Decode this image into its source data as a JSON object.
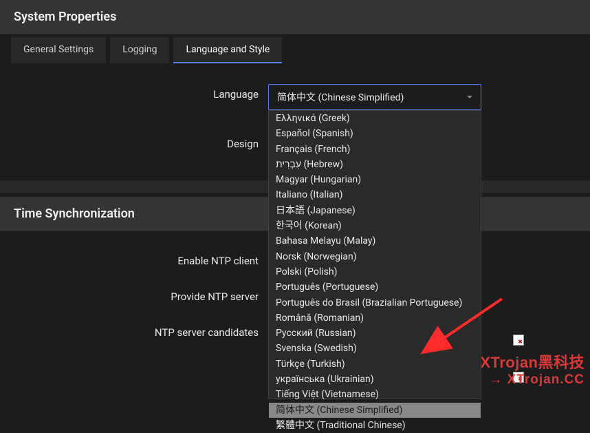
{
  "header1": "System Properties",
  "tabs": {
    "t0": "General Settings",
    "t1": "Logging",
    "t2": "Language and Style"
  },
  "labels": {
    "language": "Language",
    "design": "Design",
    "enable_ntp": "Enable NTP client",
    "provide_ntp": "Provide NTP server",
    "ntp_candidates": "NTP server candidates"
  },
  "select": {
    "language_value": "简体中文 (Chinese Simplified)"
  },
  "dropdown_items": [
    "Ελληνικά (Greek)",
    "Español (Spanish)",
    "Français (French)",
    "עִבְרִית (Hebrew)",
    "Magyar (Hungarian)",
    "Italiano (Italian)",
    "日本語 (Japanese)",
    "한국어 (Korean)",
    "Bahasa Melayu (Malay)",
    "Norsk (Norwegian)",
    "Polski (Polish)",
    "Português (Portuguese)",
    "Português do Brasil (Brazialian Portuguese)",
    "Română (Romanian)",
    "Русский (Russian)",
    "Svenska (Swedish)",
    "Türkçe (Turkish)",
    "українська (Ukrainian)",
    "Tiếng Việt (Vietnamese)",
    "简体中文 (Chinese Simplified)",
    "繁體中文 (Traditional Chinese)"
  ],
  "header2": "Time Synchronization",
  "watermark": {
    "line1": "XTrojan黑科技",
    "line2": "→ XTrojan.CC"
  }
}
